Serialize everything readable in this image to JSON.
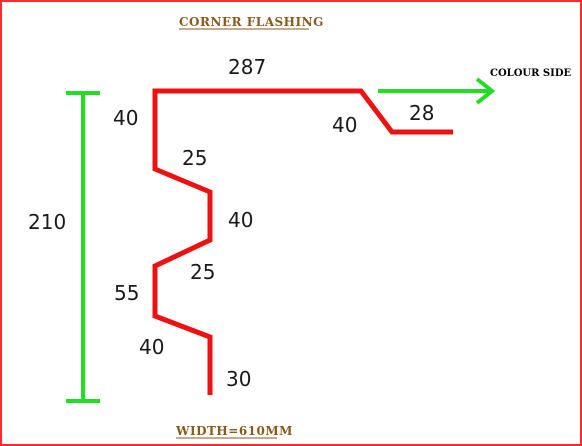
{
  "title": "CORNER FLASHING",
  "footer": "WIDTH=610MM",
  "colour_side_label": "COLOUR SIDE",
  "overall_height_label": "210",
  "profile_dimensions": {
    "top_flat": "287",
    "top_return": "40",
    "drip_angle": "40",
    "drip_flat": "28",
    "zig_1": "25",
    "vertical_1": "40",
    "zig_2": "25",
    "vertical_2": "55",
    "zig_3": "40",
    "bottom_leg": "30"
  },
  "colors": {
    "profile": "#ee1111",
    "dimension_bar": "#22dd22",
    "arrow": "#22dd22",
    "frame": "#ff2a2a",
    "title": "#8b5a1a"
  }
}
